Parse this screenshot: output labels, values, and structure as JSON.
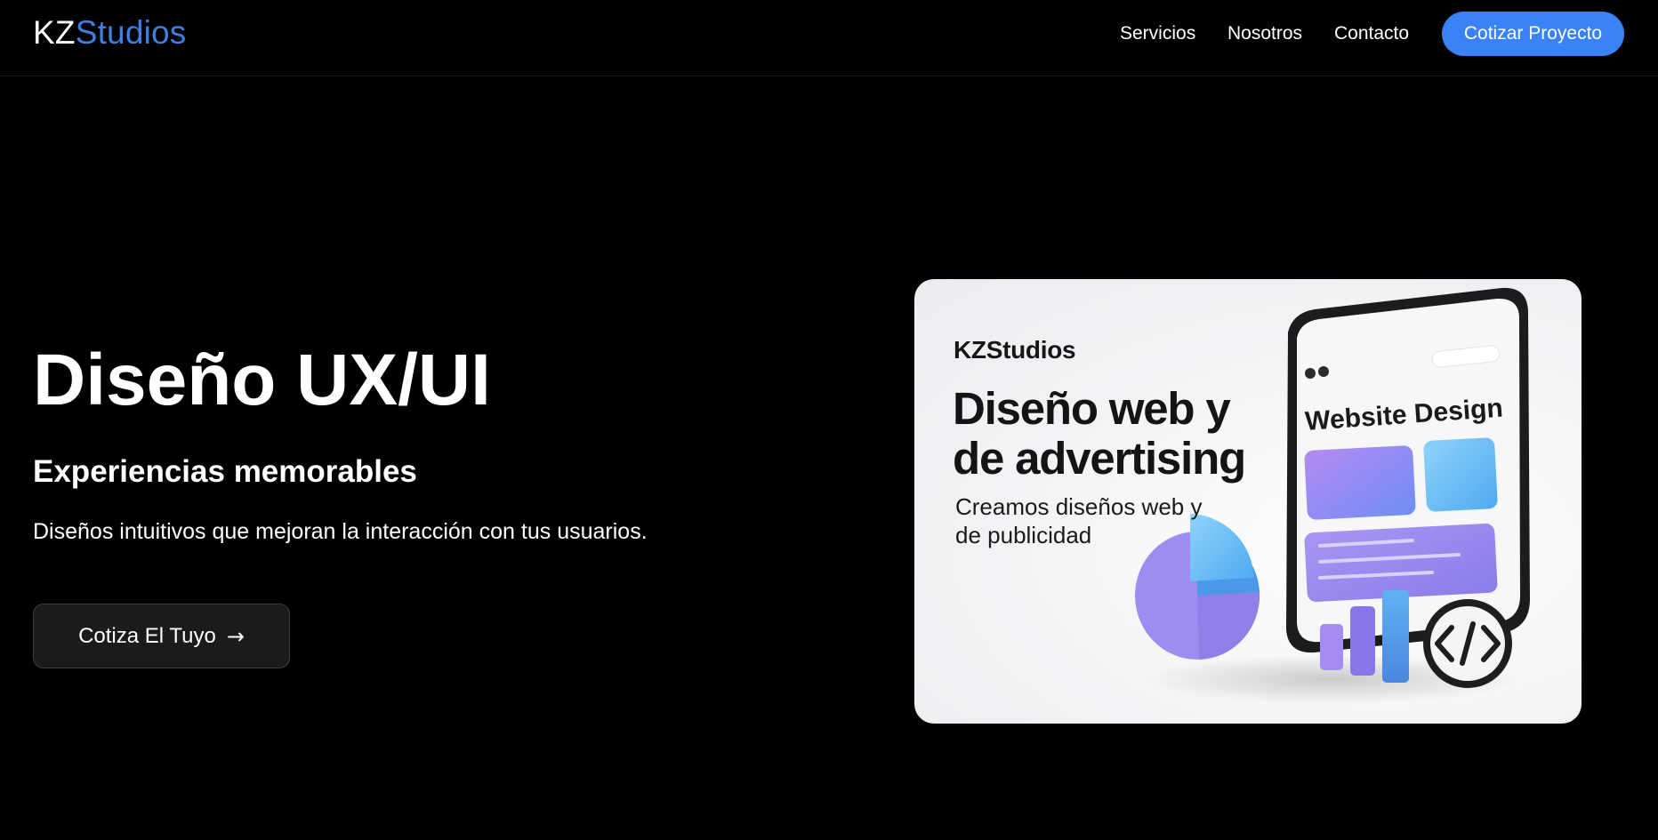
{
  "nav": {
    "logo_kz": "KZ",
    "logo_studios": "Studios",
    "links": [
      "Servicios",
      "Nosotros",
      "Contacto"
    ],
    "cta_label": "Cotizar Proyecto"
  },
  "hero": {
    "title": "Diseño UX/UI",
    "subtitle": "Experiencias memorables",
    "description": "Diseños intuitivos que mejoran la interacción con tus usuarios.",
    "button_label": "Cotiza El Tuyo",
    "button_arrow": "→"
  },
  "card": {
    "brand": "KZStudios",
    "title": "Diseño web y de advertising",
    "description": "Creamos diseños web y de publicidad",
    "phone_label": "Website Design"
  },
  "colors": {
    "accent": "#3b82f6",
    "logo_accent": "#3f7fe0",
    "background": "#000000",
    "button_dark": "#1b1b1b"
  },
  "icons": {
    "arrow": "arrow-right-icon",
    "code": "code-icon",
    "chart": "pie-chart-icon",
    "bars": "bar-chart-icon"
  }
}
